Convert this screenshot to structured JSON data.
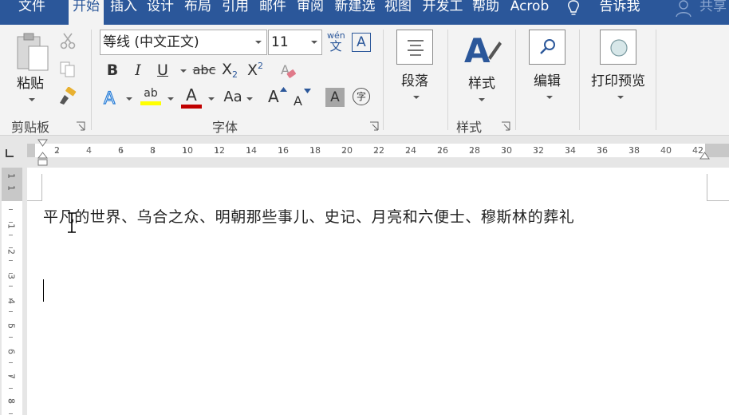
{
  "tabs": [
    {
      "label": "文件",
      "active": false
    },
    {
      "label": "开始",
      "active": true
    },
    {
      "label": "插入",
      "active": false
    },
    {
      "label": "设计",
      "active": false
    },
    {
      "label": "布局",
      "active": false
    },
    {
      "label": "引用",
      "active": false
    },
    {
      "label": "邮件",
      "active": false
    },
    {
      "label": "审阅",
      "active": false
    },
    {
      "label": "新建选",
      "active": false
    },
    {
      "label": "视图",
      "active": false
    },
    {
      "label": "开发工",
      "active": false
    },
    {
      "label": "帮助",
      "active": false
    },
    {
      "label": "Acrob",
      "active": false
    }
  ],
  "tell_me": "告诉我",
  "share": "共享",
  "clipboard": {
    "paste": "粘贴",
    "group": "剪贴板"
  },
  "font": {
    "name": "等线 (中文正文)",
    "size": "11",
    "phonetic_top": "wén",
    "phonetic_bottom": "文",
    "border_char": "A",
    "bold": "B",
    "italic": "I",
    "underline": "U",
    "strike": "abc",
    "subscript": "X",
    "sub_index": "2",
    "superscript": "X",
    "sup_index": "2",
    "change_case": "Aa",
    "grow": "A",
    "shrink": "A",
    "shade": "A",
    "enclose": "字",
    "highlight_text": "ab",
    "font_color": "A",
    "group": "字体"
  },
  "paragraph": {
    "label": "段落"
  },
  "styles": {
    "label": "样式",
    "group": "样式"
  },
  "editing": {
    "label": "编辑"
  },
  "print_preview": {
    "label": "打印预览"
  },
  "ruler": [
    "2",
    "4",
    "6",
    "8",
    "10",
    "12",
    "14",
    "16",
    "18",
    "20",
    "22",
    "24",
    "26",
    "28",
    "30",
    "32",
    "34",
    "36",
    "38",
    "40",
    "42"
  ],
  "vruler": [
    "1",
    "1",
    "1",
    "2",
    "3",
    "4",
    "5",
    "6",
    "7",
    "8"
  ],
  "document": {
    "line1": "平凡的世界、乌合之众、明朝那些事儿、史记、月亮和六便士、穆斯林的葬礼"
  },
  "colors": {
    "tab_bar": "#2b579a",
    "ribbon": "#f3f3f3",
    "highlight": "#ffff00",
    "font_color": "#c00000",
    "style_blue": "#2b579a"
  }
}
